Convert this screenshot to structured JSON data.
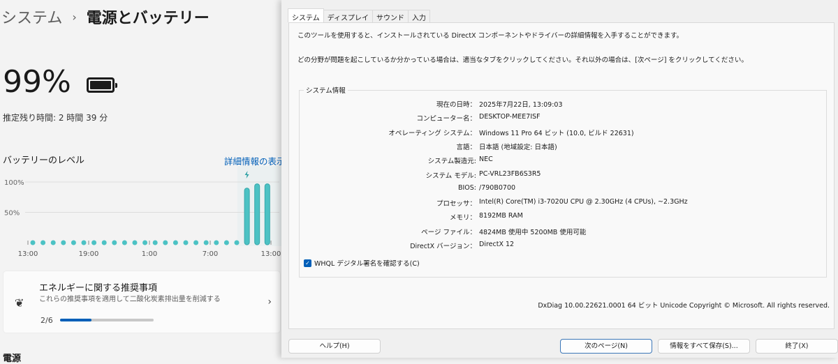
{
  "breadcrumb": {
    "parent": "システム",
    "separator": "›",
    "current": "電源とバッテリー"
  },
  "battery": {
    "percent": "99%",
    "level_fraction": 0.99,
    "remaining": "推定残り時間: 2 時間 39 分"
  },
  "level_section": {
    "title": "バッテリーのレベル",
    "details_link": "詳細情報の表示"
  },
  "chart_data": {
    "type": "bar",
    "title": "バッテリーのレベル",
    "y_ticks": [
      "100%",
      "50%"
    ],
    "ylim": [
      0,
      100
    ],
    "x_ticks": [
      "13:00",
      "19:00",
      "1:00",
      "7:00",
      "13:00"
    ],
    "values": [
      null,
      null,
      null,
      null,
      null,
      null,
      null,
      null,
      null,
      null,
      null,
      null,
      null,
      null,
      null,
      null,
      null,
      null,
      null,
      null,
      null,
      90,
      97,
      97
    ],
    "charging_index": 21,
    "color": "#4cc2c4"
  },
  "recommendation": {
    "title": "エネルギーに関する推奨事項",
    "subtitle": "これらの推奨事項を適用して二酸化炭素排出量を削減する",
    "progress_label": "2/6",
    "progress": 0.333
  },
  "next_section": "電源",
  "dxdiag": {
    "tabs": [
      "システム",
      "ディスプレイ",
      "サウンド",
      "入力"
    ],
    "intro1": "このツールを使用すると、インストールされている DirectX コンポーネントやドライバーの詳細情報を入手することができます。",
    "intro2": "どの分野が問題を起こしているか分かっている場合は、適当なタブをクリックしてください。それ以外の場合は、[次ページ] をクリックしてください。",
    "group_title": "システム情報",
    "rows": [
      {
        "k": "現在の日時：",
        "v": "2025年7月22日, 13:09:03"
      },
      {
        "k": "コンピューター名：",
        "v": "DESKTOP-MEE7ISF"
      },
      {
        "k": "オペレーティング システム：",
        "v": "Windows 11 Pro 64 ビット (10.0, ビルド 22631)"
      },
      {
        "k": "言語：",
        "v": "日本語 (地域設定: 日本語)"
      },
      {
        "k": "システム製造元:",
        "v": "NEC"
      },
      {
        "k": "システム モデル:",
        "v": "PC-VRL23FB6S3R5"
      },
      {
        "k": "BIOS:",
        "v": "/790B0700"
      },
      {
        "k": "プロセッサ：",
        "v": "Intel(R) Core(TM) i3-7020U CPU @ 2.30GHz (4 CPUs), ~2.3GHz"
      },
      {
        "k": "メモリ：",
        "v": "8192MB RAM"
      },
      {
        "k": "ページ ファイル：",
        "v": "4824MB 使用中 5200MB 使用可能"
      },
      {
        "k": "DirectX バージョン：",
        "v": "DirectX 12"
      }
    ],
    "whql": "WHQL デジタル署名を確認する(C)",
    "version": "DxDiag 10.00.22621.0001 64 ビット Unicode  Copyright © Microsoft. All rights reserved.",
    "buttons": {
      "help": "ヘルプ(H)",
      "next": "次のページ(N)",
      "save": "情報をすべて保存(S)...",
      "exit": "終了(X)"
    }
  }
}
